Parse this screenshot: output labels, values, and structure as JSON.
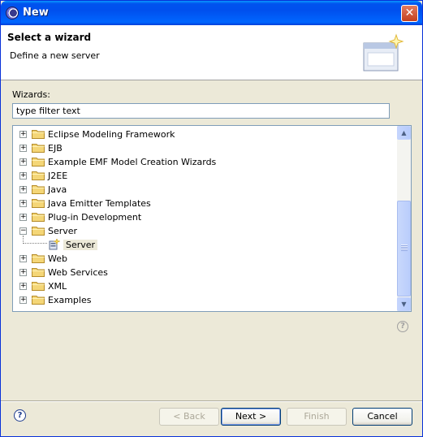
{
  "window": {
    "title": "New",
    "close_glyph": "✕"
  },
  "banner": {
    "title": "Select a wizard",
    "description": "Define a new server"
  },
  "wizards_label": "Wizards:",
  "filter": {
    "value": "type filter text"
  },
  "tree": {
    "items": [
      {
        "label": "Eclipse Modeling Framework",
        "expander": "+"
      },
      {
        "label": "EJB",
        "expander": "+"
      },
      {
        "label": "Example EMF Model Creation Wizards",
        "expander": "+"
      },
      {
        "label": "J2EE",
        "expander": "+"
      },
      {
        "label": "Java",
        "expander": "+"
      },
      {
        "label": "Java Emitter Templates",
        "expander": "+"
      },
      {
        "label": "Plug-in Development",
        "expander": "+"
      },
      {
        "label": "Server",
        "expander": "−",
        "expanded": true,
        "children": [
          {
            "label": "Server",
            "selected": true
          }
        ]
      },
      {
        "label": "Web",
        "expander": "+"
      },
      {
        "label": "Web Services",
        "expander": "+"
      },
      {
        "label": "XML",
        "expander": "+"
      },
      {
        "label": "Examples",
        "expander": "+"
      }
    ]
  },
  "scroll": {
    "up_glyph": "▲",
    "down_glyph": "▼"
  },
  "help_glyph": "?",
  "buttons": {
    "back": "< Back",
    "next": "Next >",
    "finish": "Finish",
    "cancel": "Cancel"
  },
  "colors": {
    "titlebar": "#0055ea",
    "dialog_bg": "#ece9d8",
    "selection_bg": "#ece9d8",
    "folder": "#f4d677"
  }
}
